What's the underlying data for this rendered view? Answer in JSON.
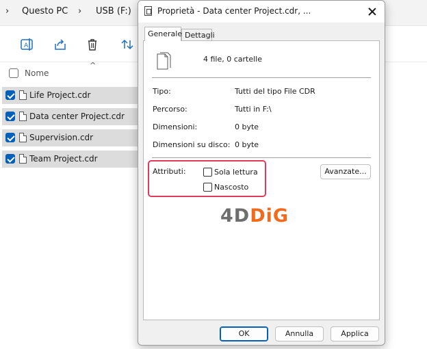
{
  "explorer": {
    "breadcrumb": [
      "Questo PC",
      "USB (F:)"
    ],
    "column_name": "Nome",
    "files": [
      "Life Project.cdr",
      "Data center Project.cdr",
      "Supervision.cdr",
      "Team Project.cdr"
    ]
  },
  "dialog": {
    "title": "Proprietà - Data center Project.cdr, ...",
    "tabs": [
      "Generale",
      "Dettagli"
    ],
    "summary": "4 file, 0 cartelle",
    "props": [
      {
        "label": "Tipo:",
        "value": "Tutti del tipo File CDR"
      },
      {
        "label": "Percorso:",
        "value": "Tutti in F:\\"
      },
      {
        "label": "Dimensioni:",
        "value": "0 byte"
      },
      {
        "label": "Dimensioni su disco:",
        "value": "0 byte"
      }
    ],
    "attributes_label": "Attributi:",
    "readonly_label": "Sola lettura",
    "hidden_label": "Nascosto",
    "advanced_label": "Avanzate...",
    "ok_label": "OK",
    "cancel_label": "Annulla",
    "apply_label": "Applica"
  },
  "watermark": {
    "part1": "4D",
    "part2": "DiG"
  },
  "colors": {
    "accent": "#005fb8",
    "highlight": "#e03a5b",
    "watermark_orange": "#f26b1d"
  }
}
